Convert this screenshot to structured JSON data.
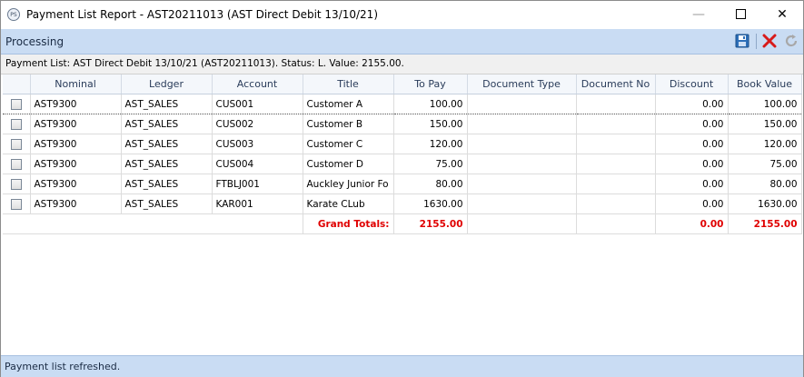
{
  "window": {
    "title": "Payment List Report - AST20211013 (AST Direct Debit 13/10/21)",
    "icon_label": "PS",
    "controls": {
      "minimize": "—",
      "close": "✕"
    }
  },
  "toolbar": {
    "label": "Processing",
    "icons": [
      "save-icon",
      "delete-icon",
      "refresh-icon"
    ]
  },
  "info": {
    "text": "Payment List: AST Direct Debit 13/10/21 (AST20211013). Status: L. Value: 2155.00."
  },
  "grid": {
    "columns": [
      "",
      "Nominal",
      "Ledger",
      "Account",
      "Title",
      "To Pay",
      "Document Type",
      "Document No",
      "Discount",
      "Book Value"
    ],
    "rows": [
      {
        "nominal": "AST9300",
        "ledger": "AST_SALES",
        "account": "CUS001",
        "title": "Customer A",
        "to_pay": "100.00",
        "doc_type": "",
        "doc_no": "",
        "discount": "0.00",
        "book_value": "100.00"
      },
      {
        "nominal": "AST9300",
        "ledger": "AST_SALES",
        "account": "CUS002",
        "title": "Customer B",
        "to_pay": "150.00",
        "doc_type": "",
        "doc_no": "",
        "discount": "0.00",
        "book_value": "150.00"
      },
      {
        "nominal": "AST9300",
        "ledger": "AST_SALES",
        "account": "CUS003",
        "title": "Customer C",
        "to_pay": "120.00",
        "doc_type": "",
        "doc_no": "",
        "discount": "0.00",
        "book_value": "120.00"
      },
      {
        "nominal": "AST9300",
        "ledger": "AST_SALES",
        "account": "CUS004",
        "title": "Customer D",
        "to_pay": "75.00",
        "doc_type": "",
        "doc_no": "",
        "discount": "0.00",
        "book_value": "75.00"
      },
      {
        "nominal": "AST9300",
        "ledger": "AST_SALES",
        "account": "FTBLJ001",
        "title": "Auckley Junior Fo",
        "to_pay": "80.00",
        "doc_type": "",
        "doc_no": "",
        "discount": "0.00",
        "book_value": "80.00"
      },
      {
        "nominal": "AST9300",
        "ledger": "AST_SALES",
        "account": "KAR001",
        "title": "Karate CLub",
        "to_pay": "1630.00",
        "doc_type": "",
        "doc_no": "",
        "discount": "0.00",
        "book_value": "1630.00"
      }
    ],
    "totals": {
      "label": "Grand Totals:",
      "to_pay": "2155.00",
      "discount": "0.00",
      "book_value": "2155.00"
    }
  },
  "status": {
    "text": "Payment list refreshed."
  },
  "colors": {
    "toolbar_bg": "#c9dcf3",
    "totals_text": "#e00000",
    "header_text": "#2a3c5a"
  }
}
